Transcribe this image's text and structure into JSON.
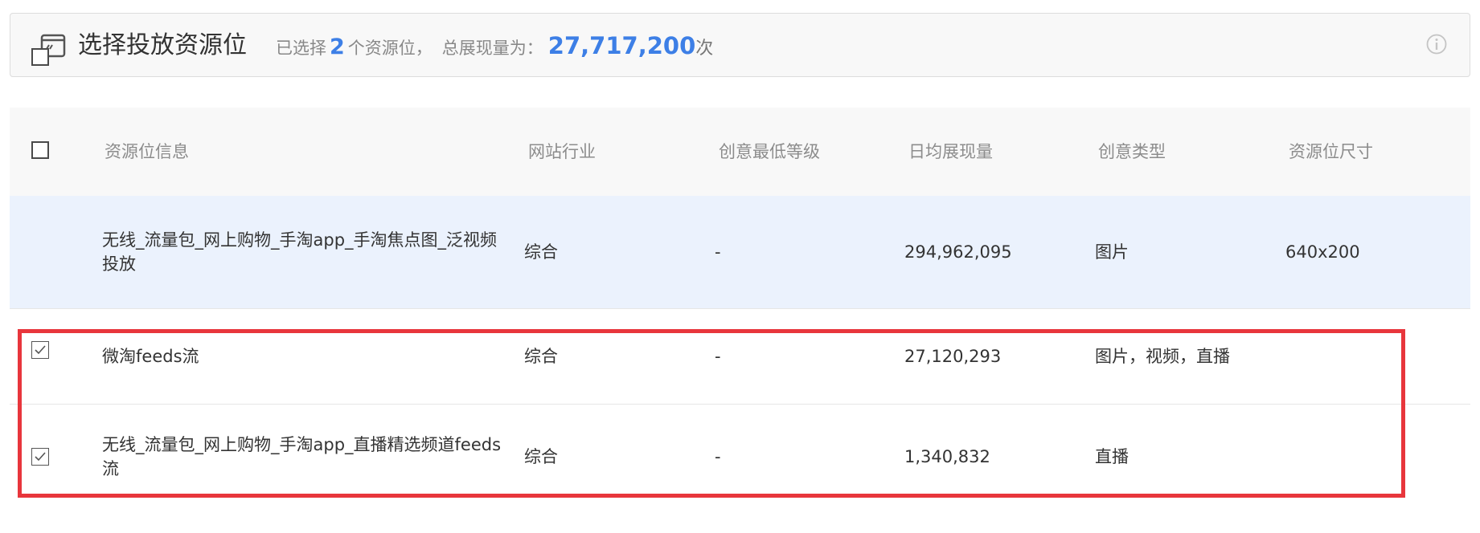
{
  "header": {
    "title": "选择投放资源位",
    "selected_prefix": "已选择",
    "selected_count": "2",
    "selected_suffix": "个资源位，",
    "total_label": "总展现量为：",
    "total_value": "27,717,200",
    "total_unit": "次",
    "title_icon": "monitor-icon",
    "info_icon": "info-icon"
  },
  "table": {
    "columns": [
      "资源位信息",
      "网站行业",
      "创意最低等级",
      "日均展现量",
      "创意类型",
      "资源位尺寸"
    ],
    "rows": [
      {
        "checked": false,
        "name": "无线_流量包_网上购物_手淘app_手淘焦点图_泛视频投放",
        "industry": "综合",
        "level": "-",
        "impressions": "294,962,095",
        "creative_type": "图片",
        "size": "640x200"
      },
      {
        "checked": true,
        "name": "微淘feeds流",
        "industry": "综合",
        "level": "-",
        "impressions": "27,120,293",
        "creative_type": "图片，视频，直播",
        "size": ""
      },
      {
        "checked": true,
        "name": "无线_流量包_网上购物_手淘app_直播精选频道feeds流",
        "industry": "综合",
        "level": "-",
        "impressions": "1,340,832",
        "creative_type": "直播",
        "size": ""
      }
    ]
  },
  "colors": {
    "accent": "#3d7fe6",
    "selected_row_bg": "#ebf2fd",
    "highlight_border": "#e8363c",
    "header_bg": "#f8f8f8"
  }
}
